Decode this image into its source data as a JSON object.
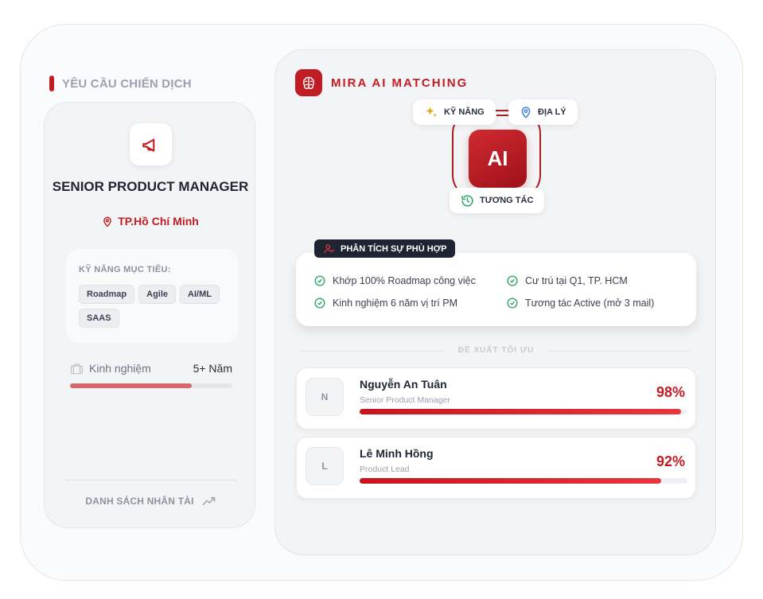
{
  "campaign": {
    "section_title": "YÊU CẦU CHIẾN DỊCH",
    "job_title": "SENIOR PRODUCT MANAGER",
    "location": "TP.Hồ Chí Minh",
    "skills_label": "KỸ NĂNG MỤC TIÊU:",
    "skills": [
      "Roadmap",
      "Agile",
      "AI/ML",
      "SAAS"
    ],
    "experience_label": "Kinh nghiệm",
    "experience_value": "5+ Năm",
    "experience_progress": 0.75,
    "talent_link": "DANH SÁCH NHÂN TÀI"
  },
  "matching": {
    "brand_title": "MIRA AI MATCHING",
    "ai_label": "AI",
    "pills": {
      "skill": "KỸ NĂNG",
      "geo": "ĐỊA LÝ",
      "interaction": "TƯƠNG TÁC"
    },
    "analysis_title": "PHÂN TÍCH SỰ PHÙ HỢP",
    "analysis_items": [
      "Khớp 100% Roadmap công việc",
      "Cư trú tại Q1, TP. HCM",
      "Kinh nghiệm 6 năm vị trí PM",
      "Tương tác Active (mở 3 mail)"
    ],
    "recommend_label": "ĐỀ XUẤT TỐI ƯU",
    "candidates": [
      {
        "initial": "N",
        "name": "Nguyễn An Tuân",
        "role": "Senior Product Manager",
        "score": "98%",
        "progress": 0.98
      },
      {
        "initial": "L",
        "name": "Lê Minh Hồng",
        "role": "Product Lead",
        "score": "92%",
        "progress": 0.92
      }
    ]
  },
  "colors": {
    "accent": "#c11c24",
    "check": "#2fa866",
    "dark": "#1f2432"
  }
}
